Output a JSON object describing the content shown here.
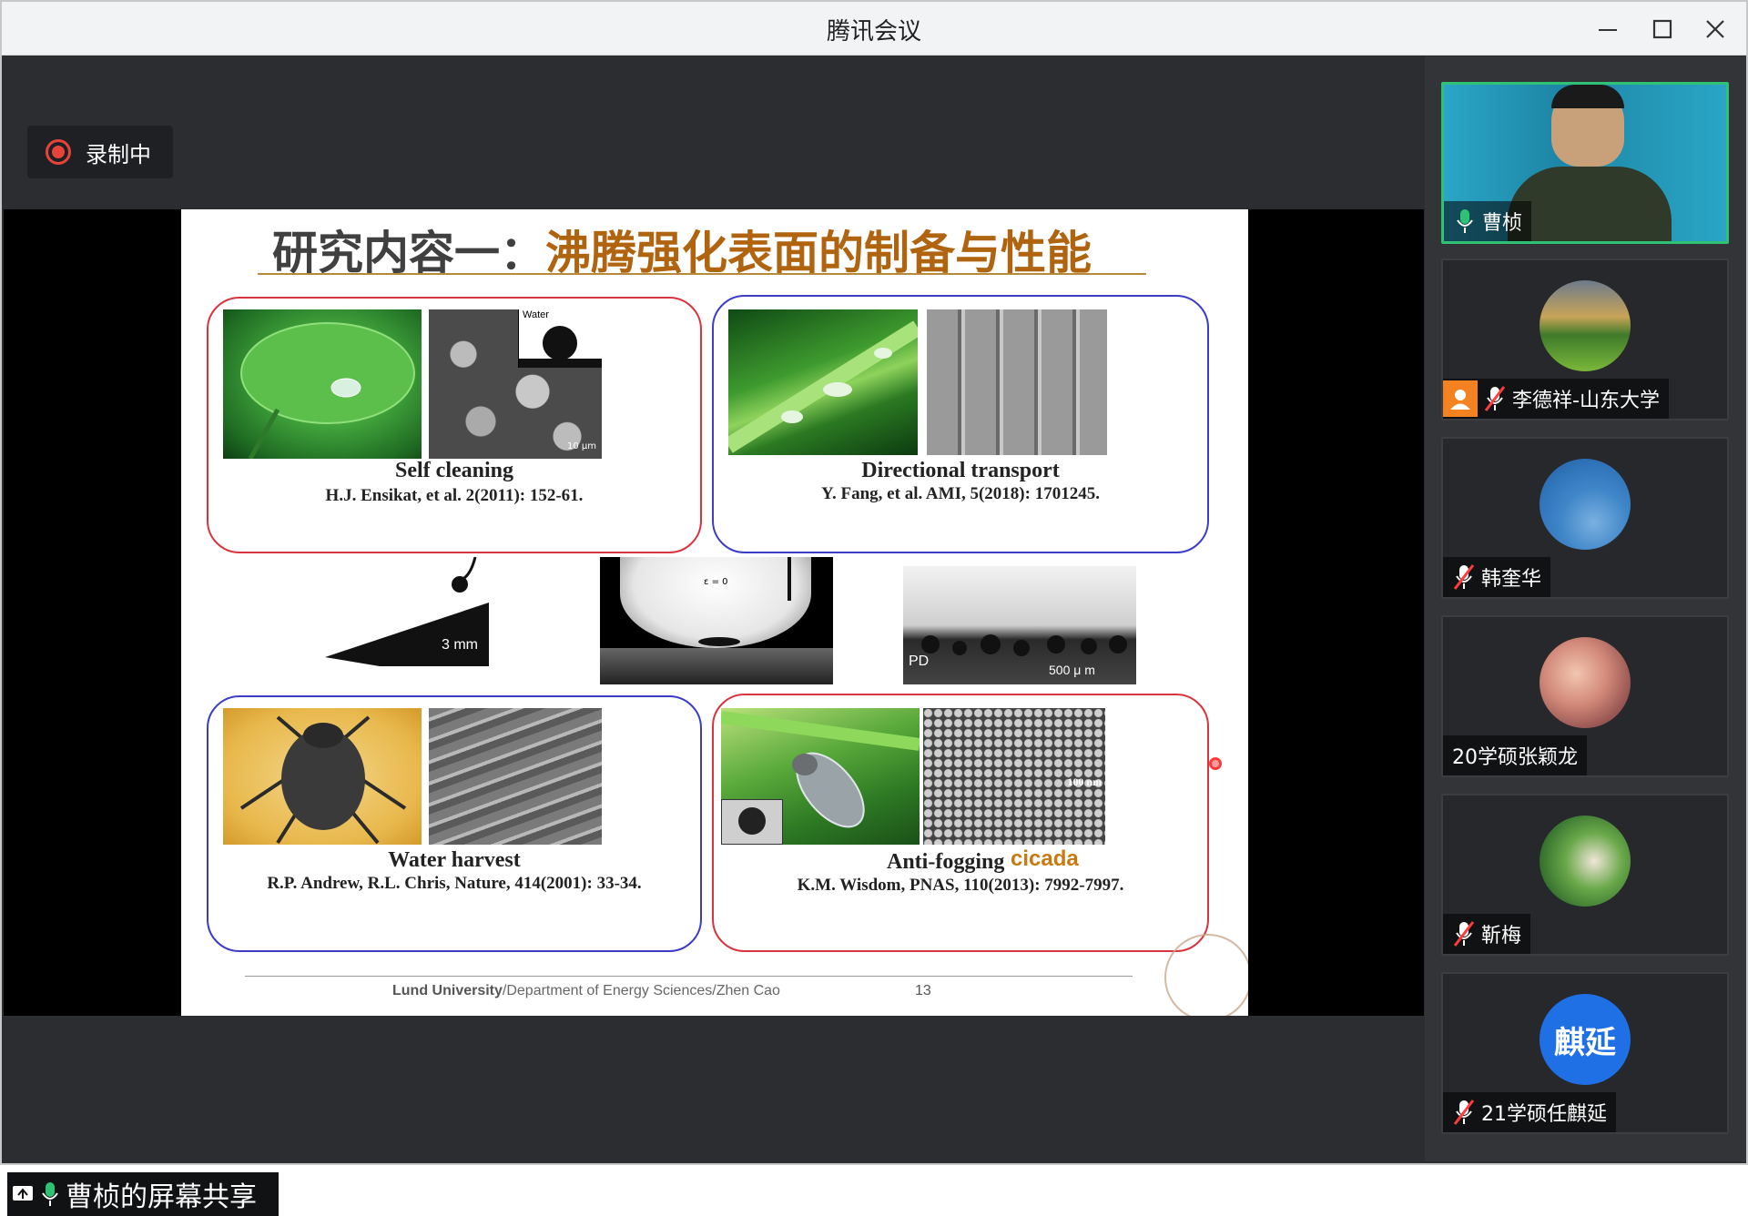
{
  "window": {
    "title": "腾讯会议"
  },
  "recording": {
    "label": "录制中"
  },
  "slide": {
    "title_prefix": "研究内容一：",
    "title_highlight": "沸腾强化表面的制备与性能",
    "panels": [
      {
        "title": "Self cleaning",
        "ref": "H.J. Ensikat, et al. 2(2011): 152-61.",
        "inset_label": "Water",
        "scale_label": "10 µm"
      },
      {
        "title": "Directional transport",
        "ref": "Y. Fang, et al. AMI, 5(2018): 1701245."
      },
      {
        "title": "Water harvest",
        "ref": "R.P. Andrew, R.L. Chris, Nature, 414(2001): 33-34."
      },
      {
        "title": "Anti-fogging",
        "extra": "cicada",
        "ref": "K.M. Wisdom, PNAS, 110(2013): 7992-7997.",
        "scale_label": "100 nm"
      }
    ],
    "middle": {
      "slope_scale": "3 mm",
      "contact_label": "ε = 0",
      "droplets_pd": "PD",
      "droplets_scale": "500 μ m"
    },
    "footer": {
      "institution": "Lund University",
      "rest": "/Department of Energy Sciences/Zhen Cao",
      "page": "13"
    }
  },
  "share": {
    "label": "曹桢的屏幕共享"
  },
  "participants": [
    {
      "name": "曹桢",
      "mic": "on",
      "video": true,
      "active": true
    },
    {
      "name": "李德祥-山东大学",
      "mic": "off",
      "user_icon": true
    },
    {
      "name": "韩奎华",
      "mic": "off"
    },
    {
      "name": "20学硕张颖龙",
      "mic": "none"
    },
    {
      "name": "靳梅",
      "mic": "off"
    },
    {
      "name": "21学硕任麒延",
      "mic": "off",
      "initials": "麒延"
    }
  ],
  "colors": {
    "accent_green": "#2fc274",
    "record_red": "#e8433b",
    "title_gold": "#b0640f",
    "initials_blue": "#1f6fe5"
  }
}
